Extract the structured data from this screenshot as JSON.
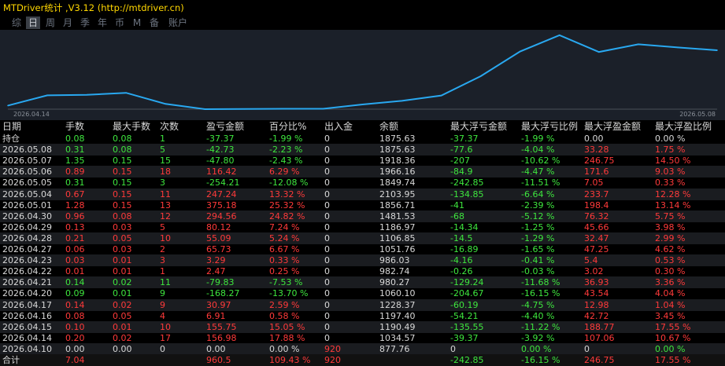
{
  "app": {
    "title": "MTDriver统计 ,V3.12 (http://mtdriver.cn)"
  },
  "period_tabs": [
    {
      "label": "综",
      "active": false
    },
    {
      "label": "日",
      "active": true
    },
    {
      "label": "周",
      "active": false
    },
    {
      "label": "月",
      "active": false
    },
    {
      "label": "季",
      "active": false
    },
    {
      "label": "年",
      "active": false
    },
    {
      "label": "币",
      "active": false
    },
    {
      "label": "M",
      "active": false
    },
    {
      "label": "备",
      "active": false
    },
    {
      "label": "账户",
      "active": false
    }
  ],
  "colors": {
    "up": "#ff3a3a",
    "down": "#3ee63e",
    "neutral": "#d8d8d8",
    "line": "#29a8f0",
    "chart_bg": "#1b2029"
  },
  "chart_data": {
    "type": "line",
    "x_start_label": "2026.04.14",
    "x_end_label": "2026.05.08",
    "x": [
      "2026.04.14",
      "2026.04.15",
      "2026.04.16",
      "2026.04.17",
      "2026.04.20",
      "2026.04.21",
      "2026.04.22",
      "2026.04.23",
      "2026.04.24",
      "2026.04.27",
      "2026.04.28",
      "2026.04.29",
      "2026.04.30",
      "2026.05.01",
      "2026.05.04",
      "2026.05.05",
      "2026.05.06",
      "2026.05.07",
      "2026.05.08"
    ],
    "values": [
      1034.57,
      1190.49,
      1197.4,
      1228.37,
      1060.1,
      980.27,
      982.74,
      986.03,
      986.03,
      1051.76,
      1106.85,
      1186.97,
      1481.53,
      1856.71,
      2103.95,
      1849.74,
      1966.16,
      1918.36,
      1875.63
    ],
    "ylim": [
      980,
      2150
    ]
  },
  "table": {
    "headers": [
      "日期",
      "手数",
      "最大手数",
      "次数",
      "盈亏金额",
      "百分比%",
      "出入金",
      "余额",
      "最大浮亏金额",
      "最大浮亏比例",
      "最大浮盈金额",
      "最大浮盈比例"
    ],
    "rows": [
      {
        "c": [
          "持仓",
          "0.08",
          "0.08",
          "1",
          "-37.37",
          "-1.99 %",
          "0",
          "1875.63",
          "-37.37",
          "-1.99 %",
          "0.00",
          "0.00 %"
        ],
        "k": [
          "w",
          "d",
          "d",
          "d",
          "d",
          "d",
          "w",
          "w",
          "d",
          "d",
          "w",
          "w"
        ]
      },
      {
        "c": [
          "2026.05.08",
          "0.31",
          "0.08",
          "5",
          "-42.73",
          "-2.23 %",
          "0",
          "1875.63",
          "-77.6",
          "-4.04 %",
          "33.28",
          "1.75 %"
        ],
        "k": [
          "w",
          "d",
          "d",
          "d",
          "d",
          "d",
          "w",
          "w",
          "d",
          "d",
          "u",
          "u"
        ]
      },
      {
        "c": [
          "2026.05.07",
          "1.35",
          "0.15",
          "15",
          "-47.80",
          "-2.43 %",
          "0",
          "1918.36",
          "-207",
          "-10.62 %",
          "246.75",
          "14.50 %"
        ],
        "k": [
          "w",
          "d",
          "d",
          "d",
          "d",
          "d",
          "w",
          "w",
          "d",
          "d",
          "u",
          "u"
        ]
      },
      {
        "c": [
          "2026.05.06",
          "0.89",
          "0.15",
          "18",
          "116.42",
          "6.29 %",
          "0",
          "1966.16",
          "-84.9",
          "-4.47 %",
          "171.6",
          "9.03 %"
        ],
        "k": [
          "w",
          "u",
          "u",
          "u",
          "u",
          "u",
          "w",
          "w",
          "d",
          "d",
          "u",
          "u"
        ]
      },
      {
        "c": [
          "2026.05.05",
          "0.31",
          "0.15",
          "3",
          "-254.21",
          "-12.08 %",
          "0",
          "1849.74",
          "-242.85",
          "-11.51 %",
          "7.05",
          "0.33 %"
        ],
        "k": [
          "w",
          "d",
          "d",
          "d",
          "d",
          "d",
          "w",
          "w",
          "d",
          "d",
          "u",
          "u"
        ]
      },
      {
        "c": [
          "2026.05.04",
          "0.67",
          "0.15",
          "11",
          "247.24",
          "13.32 %",
          "0",
          "2103.95",
          "-134.85",
          "-6.64 %",
          "233.7",
          "12.28 %"
        ],
        "k": [
          "w",
          "u",
          "u",
          "u",
          "u",
          "u",
          "w",
          "w",
          "d",
          "d",
          "u",
          "u"
        ]
      },
      {
        "c": [
          "2026.05.01",
          "1.28",
          "0.15",
          "13",
          "375.18",
          "25.32 %",
          "0",
          "1856.71",
          "-41",
          "-2.39 %",
          "198.4",
          "13.14 %"
        ],
        "k": [
          "w",
          "u",
          "u",
          "u",
          "u",
          "u",
          "w",
          "w",
          "d",
          "d",
          "u",
          "u"
        ]
      },
      {
        "c": [
          "2026.04.30",
          "0.96",
          "0.08",
          "12",
          "294.56",
          "24.82 %",
          "0",
          "1481.53",
          "-68",
          "-5.12 %",
          "76.32",
          "5.75 %"
        ],
        "k": [
          "w",
          "u",
          "u",
          "u",
          "u",
          "u",
          "w",
          "w",
          "d",
          "d",
          "u",
          "u"
        ]
      },
      {
        "c": [
          "2026.04.29",
          "0.13",
          "0.03",
          "5",
          "80.12",
          "7.24 %",
          "0",
          "1186.97",
          "-14.34",
          "-1.25 %",
          "45.66",
          "3.98 %"
        ],
        "k": [
          "w",
          "u",
          "u",
          "u",
          "u",
          "u",
          "w",
          "w",
          "d",
          "d",
          "u",
          "u"
        ]
      },
      {
        "c": [
          "2026.04.28",
          "0.21",
          "0.05",
          "10",
          "55.09",
          "5.24 %",
          "0",
          "1106.85",
          "-14.5",
          "-1.29 %",
          "32.47",
          "2.99 %"
        ],
        "k": [
          "w",
          "u",
          "u",
          "u",
          "u",
          "u",
          "w",
          "w",
          "d",
          "d",
          "u",
          "u"
        ]
      },
      {
        "c": [
          "2026.04.27",
          "0.06",
          "0.03",
          "2",
          "65.73",
          "6.67 %",
          "0",
          "1051.76",
          "-16.89",
          "-1.65 %",
          "47.25",
          "4.62 %"
        ],
        "k": [
          "w",
          "u",
          "u",
          "u",
          "u",
          "u",
          "w",
          "w",
          "d",
          "d",
          "u",
          "u"
        ]
      },
      {
        "c": [
          "2026.04.23",
          "0.03",
          "0.01",
          "3",
          "3.29",
          "0.33 %",
          "0",
          "986.03",
          "-4.16",
          "-0.41 %",
          "5.4",
          "0.53 %"
        ],
        "k": [
          "w",
          "u",
          "u",
          "u",
          "u",
          "u",
          "w",
          "w",
          "d",
          "d",
          "u",
          "u"
        ]
      },
      {
        "c": [
          "2026.04.22",
          "0.01",
          "0.01",
          "1",
          "2.47",
          "0.25 %",
          "0",
          "982.74",
          "-0.26",
          "-0.03 %",
          "3.02",
          "0.30 %"
        ],
        "k": [
          "w",
          "u",
          "u",
          "u",
          "u",
          "u",
          "w",
          "w",
          "d",
          "d",
          "u",
          "u"
        ]
      },
      {
        "c": [
          "2026.04.21",
          "0.14",
          "0.02",
          "11",
          "-79.83",
          "-7.53 %",
          "0",
          "980.27",
          "-129.24",
          "-11.68 %",
          "36.93",
          "3.36 %"
        ],
        "k": [
          "w",
          "d",
          "d",
          "d",
          "d",
          "d",
          "w",
          "w",
          "d",
          "d",
          "u",
          "u"
        ]
      },
      {
        "c": [
          "2026.04.20",
          "0.09",
          "0.01",
          "9",
          "-168.27",
          "-13.70 %",
          "0",
          "1060.10",
          "-204.67",
          "-16.15 %",
          "43.54",
          "4.04 %"
        ],
        "k": [
          "w",
          "d",
          "d",
          "d",
          "d",
          "d",
          "w",
          "w",
          "d",
          "d",
          "u",
          "u"
        ]
      },
      {
        "c": [
          "2026.04.17",
          "0.14",
          "0.02",
          "9",
          "30.97",
          "2.59 %",
          "0",
          "1228.37",
          "-60.19",
          "-4.75 %",
          "12.98",
          "1.04 %"
        ],
        "k": [
          "w",
          "u",
          "u",
          "u",
          "u",
          "u",
          "w",
          "w",
          "d",
          "d",
          "u",
          "u"
        ]
      },
      {
        "c": [
          "2026.04.16",
          "0.08",
          "0.05",
          "4",
          "6.91",
          "0.58 %",
          "0",
          "1197.40",
          "-54.21",
          "-4.40 %",
          "42.72",
          "3.45 %"
        ],
        "k": [
          "w",
          "u",
          "u",
          "u",
          "u",
          "u",
          "w",
          "w",
          "d",
          "d",
          "u",
          "u"
        ]
      },
      {
        "c": [
          "2026.04.15",
          "0.10",
          "0.01",
          "10",
          "155.75",
          "15.05 %",
          "0",
          "1190.49",
          "-135.55",
          "-11.22 %",
          "188.77",
          "17.55 %"
        ],
        "k": [
          "w",
          "u",
          "u",
          "u",
          "u",
          "u",
          "w",
          "w",
          "d",
          "d",
          "u",
          "u"
        ]
      },
      {
        "c": [
          "2026.04.14",
          "0.20",
          "0.02",
          "17",
          "156.98",
          "17.88 %",
          "0",
          "1034.57",
          "-39.37",
          "-3.92 %",
          "107.06",
          "10.67 %"
        ],
        "k": [
          "w",
          "u",
          "u",
          "u",
          "u",
          "u",
          "w",
          "w",
          "d",
          "d",
          "u",
          "u"
        ]
      },
      {
        "c": [
          "2026.04.10",
          "0.00",
          "0.00",
          "0",
          "0.00",
          "0.00 %",
          "920",
          "877.76",
          "0",
          "0.00 %",
          "0",
          "0.00 %"
        ],
        "k": [
          "w",
          "w",
          "w",
          "w",
          "w",
          "w",
          "u",
          "w",
          "w",
          "d",
          "w",
          "d"
        ]
      },
      {
        "c": [
          "合计",
          "7.04",
          "",
          "",
          "960.5",
          "109.43 %",
          "920",
          "",
          "-242.85",
          "-16.15 %",
          "246.75",
          "17.55 %"
        ],
        "k": [
          "w",
          "u",
          "u",
          "u",
          "u",
          "u",
          "u",
          "w",
          "d",
          "d",
          "u",
          "u"
        ]
      }
    ]
  }
}
